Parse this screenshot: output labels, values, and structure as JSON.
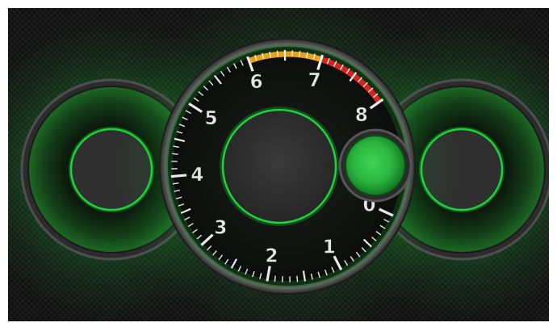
{
  "tachometer": {
    "dial_numbers": [
      "0",
      "1",
      "2",
      "3",
      "4",
      "5",
      "6",
      "7",
      "8"
    ],
    "scale_min": 0,
    "scale_max": 8,
    "warning_zone_start": 6,
    "redline_start": 7,
    "glow_color": "#1fd13a",
    "warning_color": "#e8a21a",
    "redline_color": "#d8241c",
    "tick_color": "#e8e8e8"
  },
  "indicator_lamp": {
    "lit": true,
    "color": "#2bb540"
  },
  "side_gauges": [
    {
      "position": "left",
      "ring_color": "#1fd13a"
    },
    {
      "position": "right",
      "ring_color": "#1fd13a"
    }
  ],
  "background": {
    "texture": "carbon-fiber",
    "base_color": "#161616"
  }
}
